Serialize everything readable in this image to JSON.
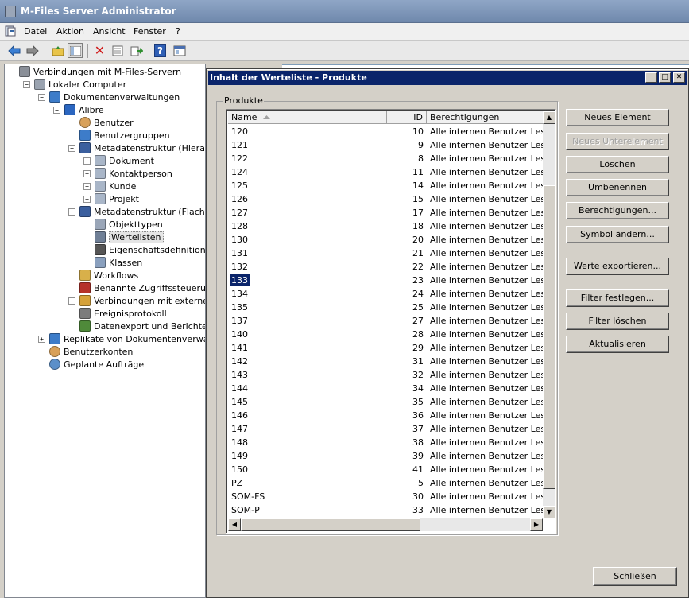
{
  "window": {
    "title": "M-Files Server Administrator"
  },
  "menu": [
    "Datei",
    "Aktion",
    "Ansicht",
    "Fenster",
    "?"
  ],
  "toolbar_icons": [
    "back-arrow-icon",
    "forward-arrow-icon",
    "up-folder-icon",
    "show-tree-icon",
    "delete-icon",
    "properties-icon",
    "export-icon",
    "help-icon",
    "console-icon"
  ],
  "tree": [
    {
      "label": "Verbindungen mit M-Files-Servern",
      "level": 0,
      "expander": "",
      "icon": "servers-icon"
    },
    {
      "label": "Lokaler Computer",
      "level": 1,
      "expander": "−",
      "icon": "computer-icon"
    },
    {
      "label": "Dokumentenverwaltungen",
      "level": 2,
      "expander": "−",
      "icon": "database-icon"
    },
    {
      "label": "Alibre",
      "level": 3,
      "expander": "−",
      "icon": "vault-icon"
    },
    {
      "label": "Benutzer",
      "level": 4,
      "expander": "",
      "icon": "user-icon"
    },
    {
      "label": "Benutzergruppen",
      "level": 4,
      "expander": "",
      "icon": "user-group-icon"
    },
    {
      "label": "Metadatenstruktur (Hierarchisch",
      "level": 4,
      "expander": "−",
      "icon": "hierarchy-icon"
    },
    {
      "label": "Dokument",
      "level": 5,
      "expander": "+",
      "icon": "document-icon"
    },
    {
      "label": "Kontaktperson",
      "level": 5,
      "expander": "+",
      "icon": "document-icon"
    },
    {
      "label": "Kunde",
      "level": 5,
      "expander": "+",
      "icon": "document-icon"
    },
    {
      "label": "Projekt",
      "level": 5,
      "expander": "+",
      "icon": "document-icon"
    },
    {
      "label": "Metadatenstruktur (Flache Ansi",
      "level": 4,
      "expander": "−",
      "icon": "list-icon"
    },
    {
      "label": "Objekttypen",
      "level": 5,
      "expander": "",
      "icon": "object-types-icon"
    },
    {
      "label": "Wertelisten",
      "level": 5,
      "expander": "",
      "icon": "value-list-icon",
      "selected": true
    },
    {
      "label": "Eigenschaftsdefinitionen",
      "level": 5,
      "expander": "",
      "icon": "property-icon"
    },
    {
      "label": "Klassen",
      "level": 5,
      "expander": "",
      "icon": "classes-icon"
    },
    {
      "label": "Workflows",
      "level": 4,
      "expander": "",
      "icon": "workflow-icon"
    },
    {
      "label": "Benannte Zugriffssteuerungslist",
      "level": 4,
      "expander": "",
      "icon": "acl-icon"
    },
    {
      "label": "Verbindungen mit externen Que",
      "level": 4,
      "expander": "+",
      "icon": "external-source-icon"
    },
    {
      "label": "Ereignisprotokoll",
      "level": 4,
      "expander": "",
      "icon": "event-log-icon"
    },
    {
      "label": "Datenexport und Berichterstellu",
      "level": 4,
      "expander": "",
      "icon": "report-icon"
    },
    {
      "label": "Replikate von Dokumentenverwaltungen",
      "level": 2,
      "expander": "+",
      "icon": "replica-icon"
    },
    {
      "label": "Benutzerkonten",
      "level": 2,
      "expander": "",
      "icon": "user-accounts-icon"
    },
    {
      "label": "Geplante Aufträge",
      "level": 2,
      "expander": "",
      "icon": "clock-icon"
    }
  ],
  "dialog": {
    "title": "Inhalt der Werteliste - Produkte",
    "group_label": "Produkte",
    "columns": [
      "Name",
      "ID",
      "Berechtigungen"
    ],
    "rows": [
      {
        "name": "120",
        "id": "10",
        "perm": "Alle internen Benutzer Lesen g"
      },
      {
        "name": "121",
        "id": "9",
        "perm": "Alle internen Benutzer Lesen g"
      },
      {
        "name": "122",
        "id": "8",
        "perm": "Alle internen Benutzer Lesen g"
      },
      {
        "name": "124",
        "id": "11",
        "perm": "Alle internen Benutzer Lesen g"
      },
      {
        "name": "125",
        "id": "14",
        "perm": "Alle internen Benutzer Lesen g"
      },
      {
        "name": "126",
        "id": "15",
        "perm": "Alle internen Benutzer Lesen g"
      },
      {
        "name": "127",
        "id": "17",
        "perm": "Alle internen Benutzer Lesen g"
      },
      {
        "name": "128",
        "id": "18",
        "perm": "Alle internen Benutzer Lesen g"
      },
      {
        "name": "130",
        "id": "20",
        "perm": "Alle internen Benutzer Lesen g"
      },
      {
        "name": "131",
        "id": "21",
        "perm": "Alle internen Benutzer Lesen g"
      },
      {
        "name": "132",
        "id": "22",
        "perm": "Alle internen Benutzer Lesen g"
      },
      {
        "name": "133",
        "id": "23",
        "perm": "Alle internen Benutzer Lesen g",
        "selected": true
      },
      {
        "name": "134",
        "id": "24",
        "perm": "Alle internen Benutzer Lesen g"
      },
      {
        "name": "135",
        "id": "25",
        "perm": "Alle internen Benutzer Lesen g"
      },
      {
        "name": "137",
        "id": "27",
        "perm": "Alle internen Benutzer Lesen g"
      },
      {
        "name": "140",
        "id": "28",
        "perm": "Alle internen Benutzer Lesen g"
      },
      {
        "name": "141",
        "id": "29",
        "perm": "Alle internen Benutzer Lesen g"
      },
      {
        "name": "142",
        "id": "31",
        "perm": "Alle internen Benutzer Lesen g"
      },
      {
        "name": "143",
        "id": "32",
        "perm": "Alle internen Benutzer Lesen g"
      },
      {
        "name": "144",
        "id": "34",
        "perm": "Alle internen Benutzer Lesen g"
      },
      {
        "name": "145",
        "id": "35",
        "perm": "Alle internen Benutzer Lesen g"
      },
      {
        "name": "146",
        "id": "36",
        "perm": "Alle internen Benutzer Lesen g"
      },
      {
        "name": "147",
        "id": "37",
        "perm": "Alle internen Benutzer Lesen g"
      },
      {
        "name": "148",
        "id": "38",
        "perm": "Alle internen Benutzer Lesen g"
      },
      {
        "name": "149",
        "id": "39",
        "perm": "Alle internen Benutzer Lesen g"
      },
      {
        "name": "150",
        "id": "41",
        "perm": "Alle internen Benutzer Lesen g"
      },
      {
        "name": "PZ",
        "id": "5",
        "perm": "Alle internen Benutzer Lesen g"
      },
      {
        "name": "SOM-FS",
        "id": "30",
        "perm": "Alle internen Benutzer Lesen g"
      },
      {
        "name": "SOM-P",
        "id": "33",
        "perm": "Alle internen Benutzer Lesen g"
      }
    ],
    "buttons": [
      {
        "label": "Neues Element",
        "name": "new-item-button",
        "enabled": true
      },
      {
        "label": "Neues Unterelement",
        "name": "new-subitem-button",
        "enabled": false
      },
      {
        "label": "Löschen",
        "name": "delete-button",
        "enabled": true
      },
      {
        "label": "Umbenennen",
        "name": "rename-button",
        "enabled": true
      },
      {
        "label": "Berechtigungen...",
        "name": "permissions-button",
        "enabled": true
      },
      {
        "label": "Symbol ändern...",
        "name": "change-icon-button",
        "enabled": true
      },
      {
        "label": "Werte exportieren...",
        "name": "export-values-button",
        "enabled": true
      },
      {
        "label": "Filter festlegen...",
        "name": "set-filter-button",
        "enabled": true
      },
      {
        "label": "Filter löschen",
        "name": "clear-filter-button",
        "enabled": true
      },
      {
        "label": "Aktualisieren",
        "name": "refresh-button",
        "enabled": true
      }
    ],
    "close_label": "Schließen"
  }
}
